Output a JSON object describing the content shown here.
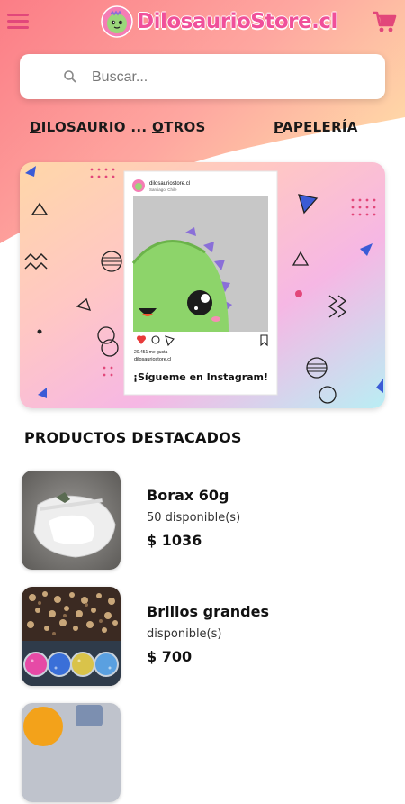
{
  "header": {
    "brand": "DilosaurioStore.cl",
    "menu_icon": "hamburger-menu-icon",
    "cart_icon": "shopping-cart-icon"
  },
  "search": {
    "placeholder": "Buscar...",
    "icon": "search-icon"
  },
  "categories": [
    {
      "label": "DILOSAURIO ..."
    },
    {
      "label": "OTROS"
    },
    {
      "label": "PAPELERÍA"
    }
  ],
  "banner": {
    "handle": "dilosauriostore.cl",
    "location": "Santiago, Chile",
    "likes": "20.451 me gusta",
    "caption_handle": "dilosauriostore.cl",
    "cta": "¡Sígueme en Instagram!"
  },
  "featured": {
    "title": "PRODUCTOS DESTACADOS",
    "products": [
      {
        "name": "Borax 60g",
        "stock": "50 disponible(s)",
        "price": "$ 1036"
      },
      {
        "name": "Brillos grandes",
        "stock": "disponible(s)",
        "price": "$ 700"
      }
    ]
  },
  "colors": {
    "brand_pink": "#f0509a",
    "hero_start": "#fb7d86",
    "hero_end": "#ffd8a8"
  }
}
